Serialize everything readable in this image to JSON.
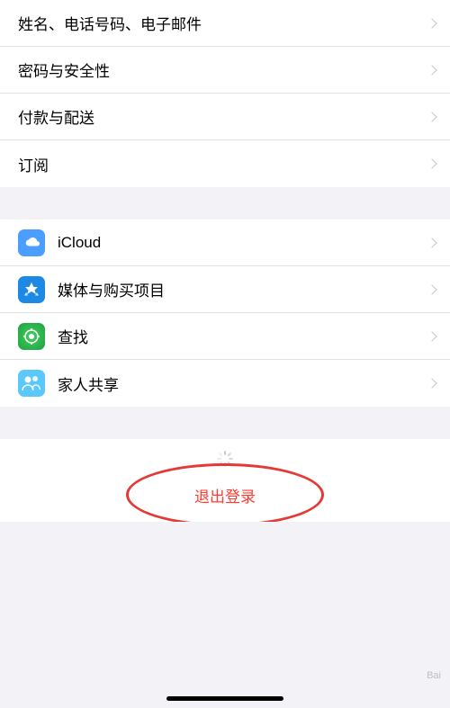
{
  "menu": {
    "group1": {
      "items": [
        {
          "id": "name-phone-email",
          "label": "姓名、电话号码、电子邮件"
        },
        {
          "id": "password-security",
          "label": "密码与安全性"
        },
        {
          "id": "payment-delivery",
          "label": "付款与配送"
        },
        {
          "id": "subscriptions",
          "label": "订阅"
        }
      ]
    },
    "group2": {
      "items": [
        {
          "id": "icloud",
          "label": "iCloud",
          "icon": "icloud"
        },
        {
          "id": "media-purchases",
          "label": "媒体与购买项目",
          "icon": "appstore"
        },
        {
          "id": "find-my",
          "label": "查找",
          "icon": "findmy"
        },
        {
          "id": "family-sharing",
          "label": "家人共享",
          "icon": "family"
        }
      ]
    },
    "signout": {
      "label": "退出登录"
    }
  },
  "colors": {
    "accent_red": "#ff3b30",
    "circle_red": "#e53935",
    "text_primary": "#000000",
    "background": "#f2f2f7",
    "chevron": "#c7c7cc"
  }
}
